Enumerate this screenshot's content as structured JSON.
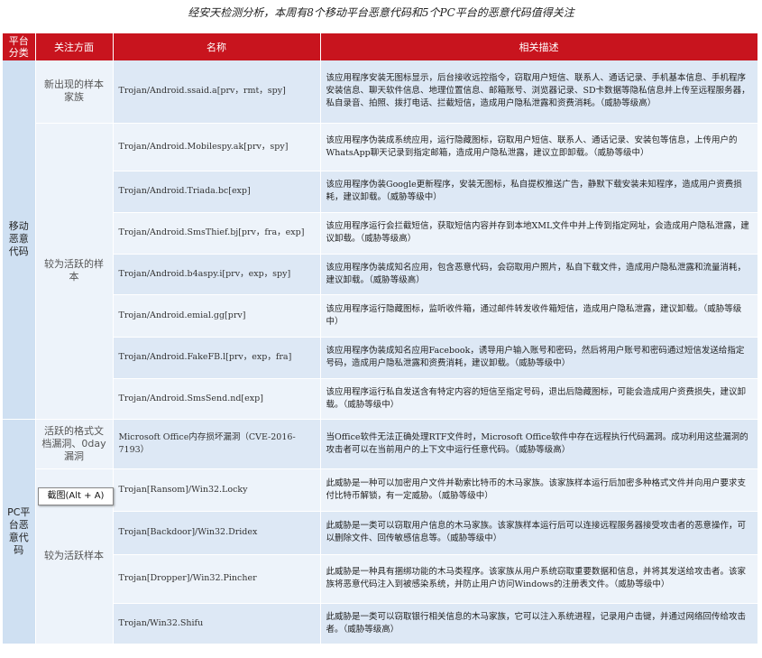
{
  "title": "经安天检测分析，本周有8个移动平台恶意代码和5个PC平台的恶意代码值得关注",
  "headers": {
    "platform": "平台分类",
    "aspect": "关注方面",
    "name": "名称",
    "desc": "相关描述"
  },
  "tooltip": "截图(Alt + A)",
  "mobile": {
    "platform": "移动恶意代码",
    "aspect_new": "新出现的样本家族",
    "aspect_active": "较为活跃的样本",
    "rows": [
      {
        "name": "Trojan/Android.ssaid.a[prv，rmt，spy]",
        "desc": "该应用程序安装无图标显示，后台接收远控指令，窃取用户短信、联系人、通话记录、手机基本信息、手机程序安装信息、聊天软件信息、地理位置信息、邮箱账号、浏览器记录、SD卡数据等隐私信息并上传至远程服务器，私自录音、拍照、拨打电话、拦截短信，造成用户隐私泄露和资费消耗。（威胁等级高）"
      },
      {
        "name": "Trojan/Android.Mobilespy.ak[prv，spy]",
        "desc": "该应用程序伪装成系统应用，运行隐藏图标，窃取用户短信、联系人、通话记录、安装包等信息，上传用户的WhatsApp聊天记录到指定邮箱，造成用户隐私泄露，建议立即卸载。（威胁等级中）"
      },
      {
        "name": "Trojan/Android.Triada.bc[exp]",
        "desc": "该应用程序伪装Google更新程序，安装无图标，私自提权推送广告，静默下载安装未知程序，造成用户资费损耗，建议卸载。（威胁等级中）"
      },
      {
        "name": "Trojan/Android.SmsThief.bj[prv，fra，exp]",
        "desc": "该应用程序运行会拦截短信，获取短信内容并存到本地XML文件中并上传到指定网址，会造成用户隐私泄露，建议卸载。（威胁等级高）"
      },
      {
        "name": "Trojan/Android.b4aspy.i[prv，exp，spy]",
        "desc": "该应用程序伪装成知名应用，包含恶意代码，会窃取用户照片，私自下载文件，造成用户隐私泄露和流量消耗，建议卸载。（威胁等级高）"
      },
      {
        "name": "Trojan/Android.emial.gg[prv]",
        "desc": "该应用程序运行隐藏图标，监听收件箱，通过邮件转发收件箱短信，造成用户隐私泄露，建议卸载。（威胁等级中）"
      },
      {
        "name": "Trojan/Android.FakeFB.l[prv，exp，fra]",
        "desc": "该应用程序伪装成知名应用Facebook，诱导用户输入账号和密码，然后将用户账号和密码通过短信发送给指定号码，造成用户隐私泄露和资费消耗，建议卸载。（威胁等级中）"
      },
      {
        "name": "Trojan/Android.SmsSend.nd[exp]",
        "desc": "该应用程序运行私自发送含有特定内容的短信至指定号码，退出后隐藏图标，可能会造成用户资费损失，建议卸载。（威胁等级中）"
      }
    ]
  },
  "pc": {
    "platform": "PC平台恶意代码",
    "aspect_vuln": "活跃的格式文档漏洞、0day漏洞",
    "aspect_active": "较为活跃样本",
    "rows": [
      {
        "name": "Microsoft Office内存损坏漏洞（CVE-2016-7193）",
        "desc": "当Office软件无法正确处理RTF文件时，Microsoft Office软件中存在远程执行代码漏洞。成功利用这些漏洞的攻击者可以在当前用户的上下文中运行任意代码。（威胁等级高）"
      },
      {
        "name": "Trojan[Ransom]/Win32.Locky",
        "desc": "此威胁是一种可以加密用户文件并勒索比特币的木马家族。该家族样本运行后加密多种格式文件并向用户要求支付比特币解锁，有一定威胁。（威胁等级中）"
      },
      {
        "name": "Trojan[Backdoor]/Win32.Dridex",
        "desc": "此威胁是一类可以窃取用户信息的木马家族。该家族样本运行后可以连接远程服务器接受攻击者的恶意操作，可以删除文件、回传敏感信息等。（威胁等级中）"
      },
      {
        "name": "Trojan[Dropper]/Win32.Pincher",
        "desc": "此威胁是一种具有捆绑功能的木马类程序。该家族从用户系统窃取重要数据和信息，并将其发送给攻击者。该家族将恶意代码注入到被感染系统，并防止用户访问Windows的注册表文件。（威胁等级中）"
      },
      {
        "name": "Trojan/Win32.Shifu",
        "desc": "此威胁是一类可以窃取银行相关信息的木马家族，它可以注入系统进程，记录用户击键，并通过网络回传给攻击者。（威胁等级高）"
      }
    ]
  }
}
